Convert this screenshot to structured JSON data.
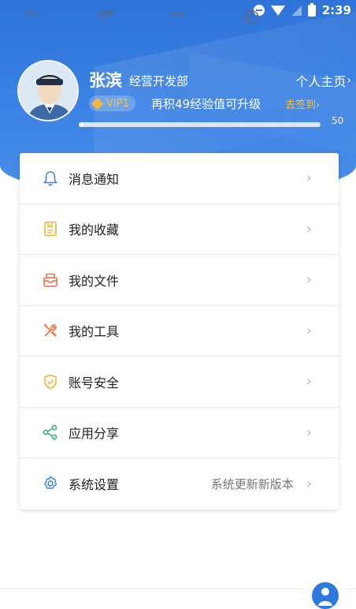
{
  "status_bar": {
    "time": "2:39",
    "icons": [
      "do-not-disturb-icon",
      "wifi-icon",
      "signal-icon",
      "battery-icon"
    ]
  },
  "profile": {
    "name": "张滨",
    "department": "经营开发部",
    "homepage_label": "个人主页",
    "homepage_arrow": "›",
    "vip_label": "VIP1",
    "upgrade_text": "再积49经验值可升级",
    "checkin_label": "去签到›",
    "progress_value": 1,
    "progress_max": "50"
  },
  "menu": {
    "items": [
      {
        "label": "消息通知",
        "icon": "bell-icon",
        "extra": "",
        "chevron": "›"
      },
      {
        "label": "我的收藏",
        "icon": "bookmark-icon",
        "extra": "",
        "chevron": "›"
      },
      {
        "label": "我的文件",
        "icon": "inbox-icon",
        "extra": "",
        "chevron": "›"
      },
      {
        "label": "我的工具",
        "icon": "tools-icon",
        "extra": "",
        "chevron": "›"
      },
      {
        "label": "账号安全",
        "icon": "shield-icon",
        "extra": "",
        "chevron": "›"
      },
      {
        "label": "应用分享",
        "icon": "share-icon",
        "extra": "",
        "chevron": "›"
      },
      {
        "label": "系统设置",
        "icon": "gear-icon",
        "extra": "系统更新新版本",
        "chevron": "›"
      }
    ]
  },
  "bottom_nav": {
    "icons": [
      "home-icon",
      "apps-icon",
      "car-icon",
      "compass-icon",
      "profile-icon"
    ]
  },
  "colors": {
    "header_blue": "#3a82e4",
    "vip_gold": "#f8c24a",
    "bell": "#4a7fd6",
    "bookmark": "#f2b233",
    "inbox": "#ef6a4c",
    "tools": "#f0703c",
    "shield": "#f3b530",
    "share": "#2fb478",
    "gear": "#3a86e0"
  }
}
